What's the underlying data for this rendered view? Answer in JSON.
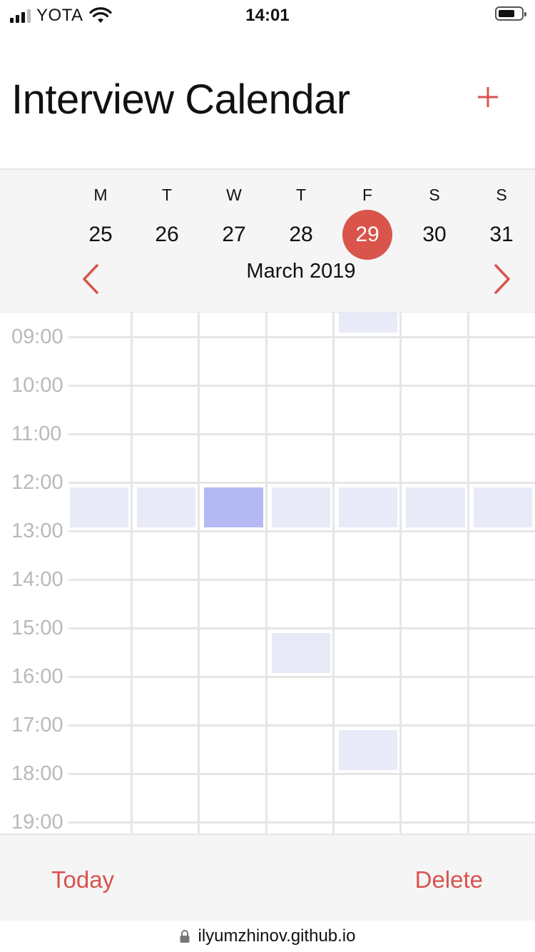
{
  "status_bar": {
    "carrier": "YOTA",
    "time": "14:01"
  },
  "header": {
    "title": "Interview Calendar",
    "add_label": "+"
  },
  "week": {
    "days": [
      {
        "letter": "M",
        "number": "25"
      },
      {
        "letter": "T",
        "number": "26"
      },
      {
        "letter": "W",
        "number": "27"
      },
      {
        "letter": "T",
        "number": "28"
      },
      {
        "letter": "F",
        "number": "29"
      },
      {
        "letter": "S",
        "number": "30"
      },
      {
        "letter": "S",
        "number": "31"
      }
    ],
    "selected_day": "29",
    "month_label": "March 2019"
  },
  "grid": {
    "hours": [
      "09:00",
      "10:00",
      "11:00",
      "12:00",
      "13:00",
      "14:00",
      "15:00",
      "16:00",
      "17:00",
      "18:00",
      "19:00"
    ],
    "events": [
      {
        "day": "F 29",
        "time": "08:00",
        "status": "available"
      },
      {
        "day": "M 25",
        "time": "12:00",
        "status": "available"
      },
      {
        "day": "T 26",
        "time": "12:00",
        "status": "available"
      },
      {
        "day": "W 27",
        "time": "12:00",
        "status": "booked"
      },
      {
        "day": "T 28",
        "time": "12:00",
        "status": "available"
      },
      {
        "day": "F 29",
        "time": "12:00",
        "status": "available"
      },
      {
        "day": "S 30",
        "time": "12:00",
        "status": "available"
      },
      {
        "day": "S 31",
        "time": "12:00",
        "status": "available"
      },
      {
        "day": "T 28",
        "time": "15:00",
        "status": "available"
      },
      {
        "day": "F 29",
        "time": "17:00",
        "status": "available"
      }
    ]
  },
  "toolbar": {
    "today_label": "Today",
    "delete_label": "Delete"
  },
  "url_bar": {
    "url": "ilyumzhinov.github.io"
  },
  "colors": {
    "accent": "#d9534f",
    "slot_available": "#e8eaf8",
    "slot_booked": "#b5b9f3",
    "grid_line": "#e6e6e6",
    "hour_label": "#b9b9b9"
  },
  "icons": {
    "prev": "chevron-left-icon",
    "next": "chevron-right-icon",
    "add": "plus-icon",
    "lock": "lock-icon",
    "wifi": "wifi-icon",
    "battery": "battery-icon",
    "signal": "signal-icon"
  }
}
